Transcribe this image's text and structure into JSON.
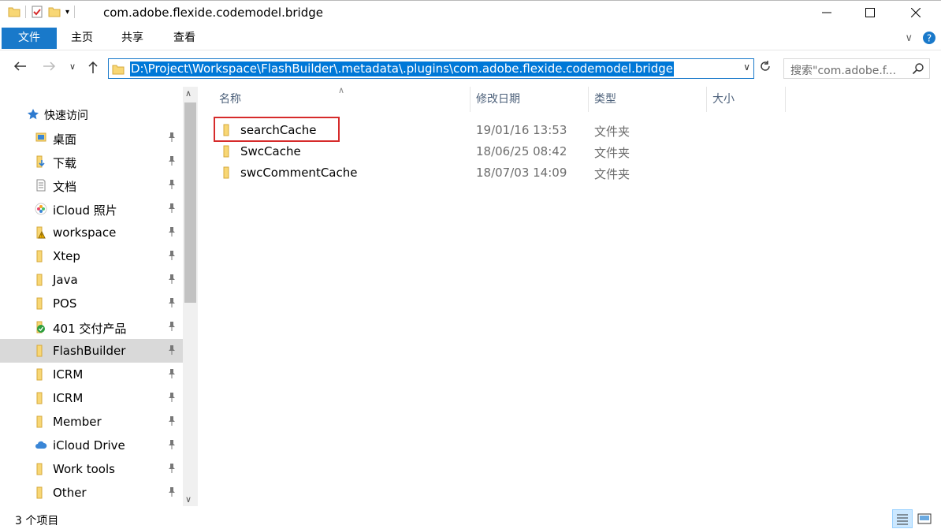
{
  "window": {
    "title": "com.adobe.flexide.codemodel.bridge",
    "min_icon": "minimize-icon",
    "max_icon": "maximize-icon",
    "close_icon": "close-icon"
  },
  "ribbon": {
    "tabs": [
      {
        "label": "文件"
      },
      {
        "label": "主页"
      },
      {
        "label": "共享"
      },
      {
        "label": "查看"
      }
    ]
  },
  "address": {
    "path": "D:\\Project\\Workspace\\FlashBuilder\\.metadata\\.plugins\\com.adobe.flexide.codemodel.bridge",
    "search_placeholder": "搜索\"com.adobe.f..."
  },
  "nav": {
    "quick_access": "快速访问",
    "items": [
      {
        "label": "桌面",
        "icon": "desktop-icon"
      },
      {
        "label": "下载",
        "icon": "download-icon"
      },
      {
        "label": "文档",
        "icon": "document-icon"
      },
      {
        "label": "iCloud 照片",
        "icon": "icloud-photos-icon"
      },
      {
        "label": "workspace",
        "icon": "folder-warning-icon"
      },
      {
        "label": "Xtep",
        "icon": "folder-icon"
      },
      {
        "label": "Java",
        "icon": "folder-icon"
      },
      {
        "label": "POS",
        "icon": "folder-icon"
      },
      {
        "label": "401 交付产品",
        "icon": "folder-check-icon"
      },
      {
        "label": "FlashBuilder",
        "icon": "folder-icon",
        "selected": true
      },
      {
        "label": "ICRM",
        "icon": "folder-icon"
      },
      {
        "label": "ICRM",
        "icon": "folder-icon"
      },
      {
        "label": "Member",
        "icon": "folder-icon"
      },
      {
        "label": "iCloud Drive",
        "icon": "icloud-drive-icon"
      },
      {
        "label": "Work tools",
        "icon": "folder-icon"
      },
      {
        "label": "Other",
        "icon": "folder-icon"
      }
    ]
  },
  "columns": {
    "name": "名称",
    "date": "修改日期",
    "type": "类型",
    "size": "大小"
  },
  "files": [
    {
      "name": "searchCache",
      "date": "19/01/16 13:53",
      "type": "文件夹"
    },
    {
      "name": "SwcCache",
      "date": "18/06/25 08:42",
      "type": "文件夹"
    },
    {
      "name": "swcCommentCache",
      "date": "18/07/03 14:09",
      "type": "文件夹"
    }
  ],
  "status": {
    "count": "3 个项目"
  },
  "colors": {
    "accent": "#1979ca",
    "selection": "#0078d7",
    "folder": "#f8d775",
    "highlight_box": "#d62b2b"
  }
}
